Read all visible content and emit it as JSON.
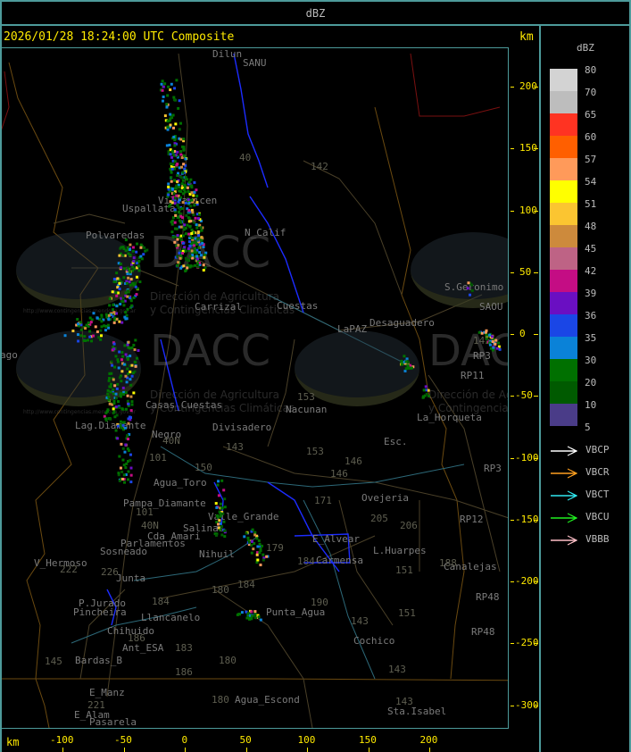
{
  "title_bar": {
    "label": "dBZ"
  },
  "header": {
    "timestamp": "2026/01/28 18:24:00 UTC Composite",
    "unit_top": "km",
    "unit_bottom": "km"
  },
  "axes": {
    "x_ticks": [
      -100,
      -50,
      0,
      50,
      100,
      150,
      200
    ],
    "y_ticks": [
      200,
      150,
      100,
      50,
      0,
      -50,
      -100,
      -150,
      -200,
      -250,
      -300
    ]
  },
  "legend": {
    "title": "dBZ",
    "levels": [
      {
        "label": "80",
        "color": "#d3d3d3"
      },
      {
        "label": "70",
        "color": "#bdbdbd"
      },
      {
        "label": "65",
        "color": "#ff3322"
      },
      {
        "label": "60",
        "color": "#ff5f00"
      },
      {
        "label": "57",
        "color": "#ff9a5a"
      },
      {
        "label": "54",
        "color": "#ffff00"
      },
      {
        "label": "51",
        "color": "#fbc531"
      },
      {
        "label": "48",
        "color": "#cd8a3c"
      },
      {
        "label": "45",
        "color": "#be6385"
      },
      {
        "label": "42",
        "color": "#c40d84"
      },
      {
        "label": "39",
        "color": "#6a0fc2"
      },
      {
        "label": "36",
        "color": "#1a46e6"
      },
      {
        "label": "35",
        "color": "#0a82d8"
      },
      {
        "label": "30",
        "color": "#007000"
      },
      {
        "label": "20",
        "color": "#005a00"
      },
      {
        "label": "10",
        "color": "#4a3c88"
      },
      {
        "label": "5",
        "color": ""
      }
    ],
    "wind_sources": [
      {
        "label": "VBCP",
        "color": "#ffffff"
      },
      {
        "label": "VBCR",
        "color": "#ffa020"
      },
      {
        "label": "VBCT",
        "color": "#30e8f0"
      },
      {
        "label": "VBCU",
        "color": "#20f020"
      },
      {
        "label": "VBBB",
        "color": "#ffc0c8"
      }
    ]
  },
  "watermark": {
    "logo": "DACC",
    "line1": "Dirección de Agricultura",
    "line2": "y Contingencias Climáticas",
    "url": "http://www.contingencias.mendoza.gov.ar"
  },
  "places": [
    "Dilun",
    "SANU",
    "Uspallata",
    "Polvaredas",
    "Villavicen",
    "N_Calif",
    "Carrizal",
    "Cuestas",
    "LaPAZ",
    "Desaguadero",
    "S.Geronimo",
    "SAOU",
    "Nacunan",
    "La_Horqueta",
    "Esc.",
    "Divisadero",
    "Negro",
    "Casas_Cuestas",
    "Lag.Diamante",
    "Agua_Toro",
    "Pampa_Diamante",
    "Valle_Grande",
    "Salinas",
    "Cda_Amari",
    "Parlamentos",
    "Sosneado",
    "Nihuil",
    "V_Hermoso",
    "Junta",
    "P.Jurado",
    "Pincheira",
    "Llancanelo",
    "Chihuido",
    "Ant_ESA",
    "Bardas_B",
    "E_Manz",
    "E_Alam",
    "Pasarela",
    "Agua_Escond",
    "Punta_Agua",
    "Sta.Isabel",
    "Cochico",
    "Carmensa",
    "L.Huarpes",
    "Ovejeria",
    "E_Alvear",
    "Canalejas",
    "RP3",
    "RP3",
    "RP11",
    "RP12",
    "RP48",
    "RP48",
    "ago"
  ],
  "routes": [
    "142",
    "40",
    "153",
    "153",
    "146",
    "146",
    "143",
    "150",
    "101",
    "40N",
    "101",
    "40N",
    "222",
    "226",
    "184",
    "180",
    "184",
    "183",
    "186",
    "186",
    "180",
    "180",
    "145",
    "221",
    "179",
    "190",
    "143",
    "151",
    "151",
    "205",
    "206",
    "188",
    "171",
    "184",
    "143",
    "145",
    "143"
  ]
}
